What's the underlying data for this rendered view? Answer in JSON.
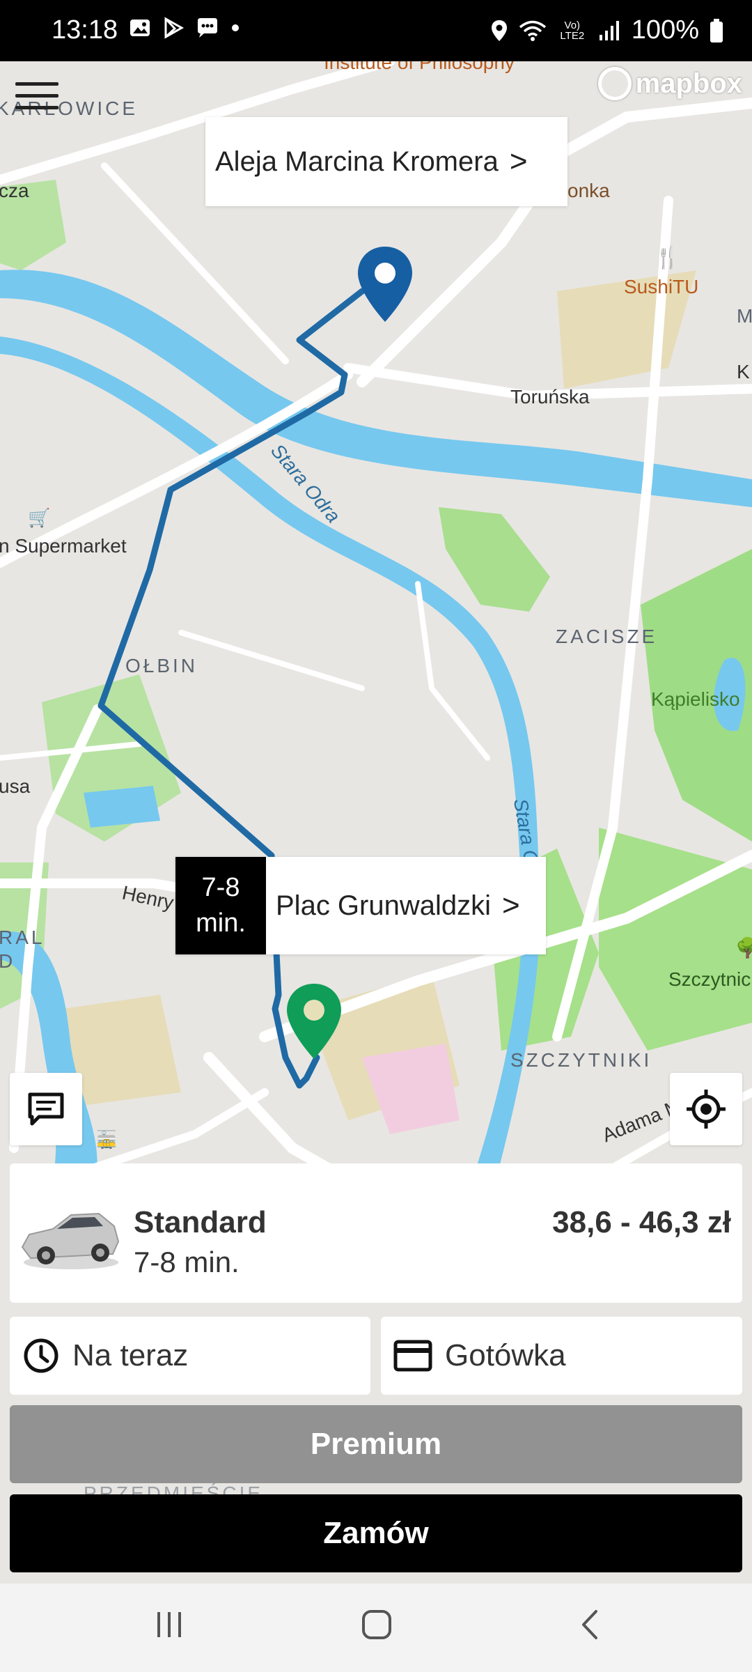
{
  "status_bar": {
    "time": "13:18",
    "battery": "100%",
    "lte": "Vo) LTE2"
  },
  "map": {
    "attribution": "mapbox",
    "labels": {
      "institute": "Institute of Philosophy",
      "karlowice": "KARŁOWICE",
      "cza": "cza",
      "onka": "onka",
      "sushi": "SushiTU",
      "torunska": "Toruńska",
      "stara_odra_1": "Stara Odra",
      "stara_odra_2": "Stara Odra",
      "supermarket": "n Supermarket",
      "zacisze": "ZACISZE",
      "olbin": "OŁBIN",
      "kapielisko": "Kąpielisko",
      "usa": "usa",
      "henry": "Henry",
      "ral": "RAL",
      "d": "D",
      "szczytnic": "Szczytnic",
      "szczytniki": "SZCZYTNIKI",
      "adama": "Adama M",
      "m_edge": "M",
      "k_edge": "K",
      "przedmiescie": "PRZEDMIEŚCIE"
    },
    "destination_callout": {
      "label": "Aleja Marcina Kromera",
      "chevron": ">"
    },
    "pickup_callout": {
      "eta_value": "7-8",
      "eta_unit": "min.",
      "label": "Plac Grunwaldzki",
      "chevron": ">"
    }
  },
  "ride_option": {
    "name": "Standard",
    "eta": "7-8 min.",
    "price": "38,6 - 46,3 zł"
  },
  "options": {
    "time_label": "Na teraz",
    "payment_label": "Gotówka"
  },
  "buttons": {
    "premium": "Premium",
    "order": "Zamów"
  },
  "colors": {
    "route": "#1f6aa5",
    "destination_pin": "#175fa3",
    "pickup_pin": "#0f9d58",
    "river": "#76c8ef",
    "park": "#a6e08a"
  }
}
